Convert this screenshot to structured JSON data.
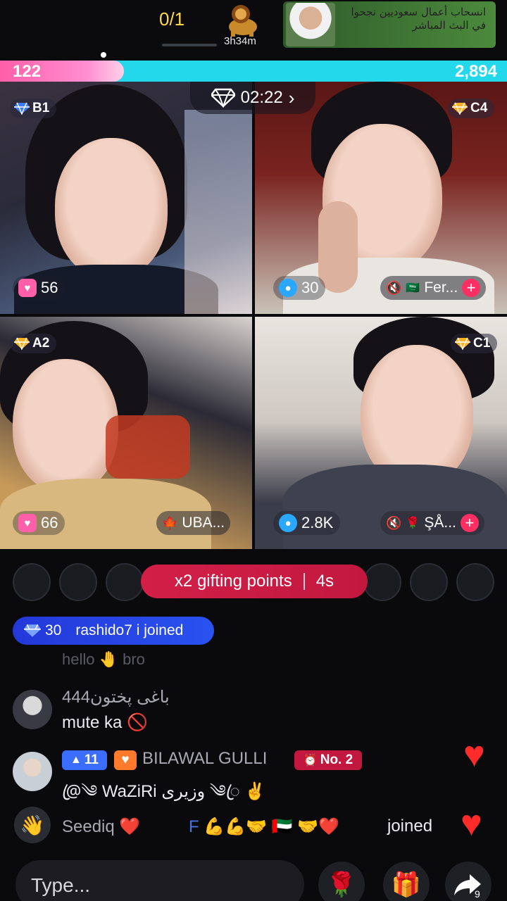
{
  "top": {
    "round_counter": "0/1",
    "badge_timer": "3h34m",
    "promo_text": "انسحاب أعمال سعوديين نجحوا في البث المباشر"
  },
  "score": {
    "left": "122",
    "right": "2,894"
  },
  "battle_timer": "02:22",
  "tiles": [
    {
      "rank": "B1",
      "rank_color": "#3a7bff",
      "points": "56",
      "points_icon_color": "#ff5fa8",
      "name": ""
    },
    {
      "rank": "C4",
      "rank_color": "#ffb020",
      "points": "30",
      "points_icon_color": "#2aa8ff",
      "name": "Fer..."
    },
    {
      "rank": "A2",
      "rank_color": "#ffb020",
      "points": "66",
      "points_icon_color": "#ff5fa8",
      "name": "UBA..."
    },
    {
      "rank": "C1",
      "rank_color": "#ffb020",
      "points": "2.8K",
      "points_icon_color": "#2aa8ff",
      "name": "ŞÅ..."
    }
  ],
  "gifting": {
    "label": "x2 gifting points",
    "countdown": "4s"
  },
  "join_pill": {
    "level": "30",
    "text": "rashido7 i joined"
  },
  "chat": {
    "faded": "hello 🤚 bro",
    "msg1": {
      "name": "باغی پختون444",
      "text": "mute ka 🚫"
    },
    "msg2": {
      "level": "11",
      "name": "BILAWAL GULLI",
      "rank": "No. 2",
      "text": "@ꦿ༄ WaZiRi وزیری ༄ꦿ ✌️"
    },
    "msg3": {
      "name": "Seediq ❤️",
      "mid": "F 💪💪🤝 🇦🇪 🤝❤️",
      "action": "joined"
    }
  },
  "input": {
    "placeholder": "Type..."
  },
  "share_count": "9",
  "colors": {
    "score_left": "#ff5fa8",
    "score_right": "#22d8ea",
    "gift_banner": "#d21f48",
    "join_pill": "#2952f0"
  }
}
